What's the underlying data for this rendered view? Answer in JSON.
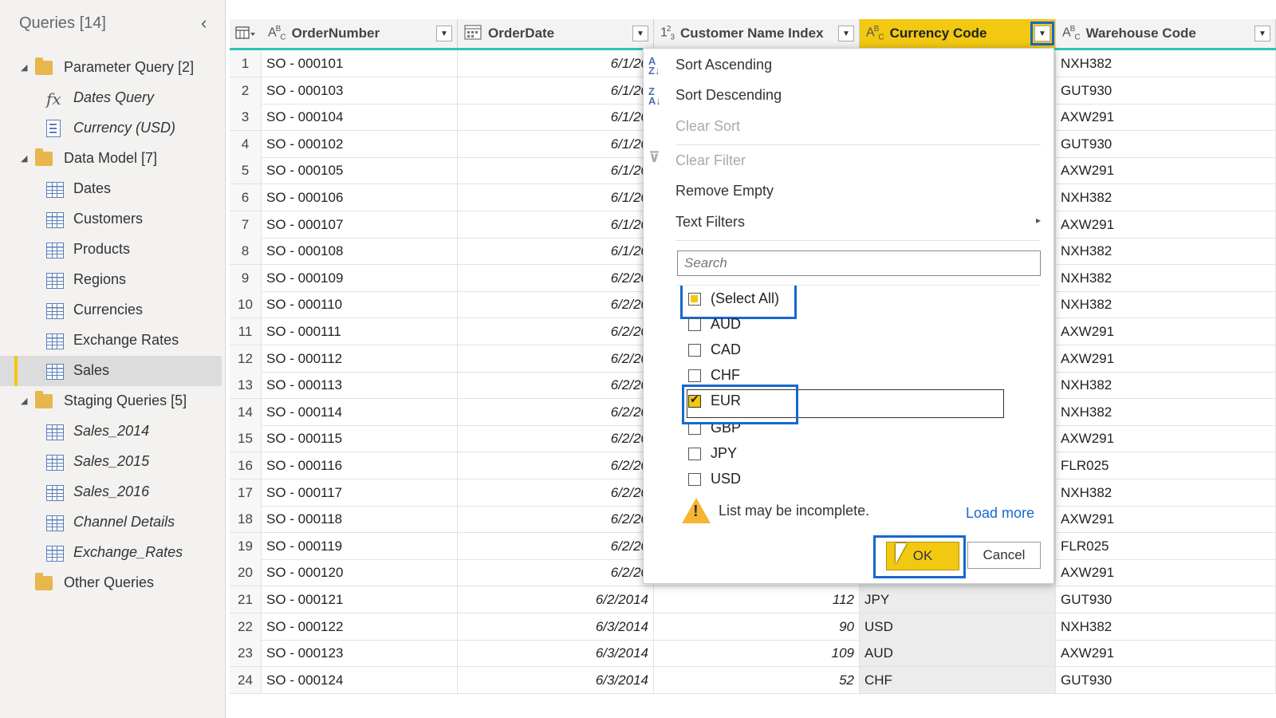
{
  "sidebar": {
    "title": "Queries [14]",
    "items": [
      {
        "label": "Parameter Query [2]",
        "type": "folder"
      },
      {
        "label": "Dates Query",
        "type": "fx"
      },
      {
        "label": "Currency (USD)",
        "type": "param"
      },
      {
        "label": "Data Model [7]",
        "type": "folder"
      },
      {
        "label": "Dates",
        "type": "table"
      },
      {
        "label": "Customers",
        "type": "table"
      },
      {
        "label": "Products",
        "type": "table"
      },
      {
        "label": "Regions",
        "type": "table"
      },
      {
        "label": "Currencies",
        "type": "table"
      },
      {
        "label": "Exchange Rates",
        "type": "table"
      },
      {
        "label": "Sales",
        "type": "table",
        "selected": true
      },
      {
        "label": "Staging Queries [5]",
        "type": "folder"
      },
      {
        "label": "Sales_2014",
        "type": "table"
      },
      {
        "label": "Sales_2015",
        "type": "table"
      },
      {
        "label": "Sales_2016",
        "type": "table"
      },
      {
        "label": "Channel Details",
        "type": "table"
      },
      {
        "label": "Exchange_Rates",
        "type": "table"
      },
      {
        "label": "Other Queries",
        "type": "folder"
      }
    ]
  },
  "grid": {
    "columns": [
      {
        "name": "OrderNumber",
        "type_icon": "ABC"
      },
      {
        "name": "OrderDate",
        "type_icon": "calendar"
      },
      {
        "name": "Customer Name Index",
        "type_icon": "123"
      },
      {
        "name": "Currency Code",
        "type_icon": "ABC"
      },
      {
        "name": "Warehouse Code",
        "type_icon": "ABC"
      }
    ],
    "rows": [
      [
        "1",
        "SO - 000101",
        "6/1/20",
        "",
        "",
        "NXH382"
      ],
      [
        "2",
        "SO - 000103",
        "6/1/20",
        "",
        "",
        "GUT930"
      ],
      [
        "3",
        "SO - 000104",
        "6/1/20",
        "",
        "",
        "AXW291"
      ],
      [
        "4",
        "SO - 000102",
        "6/1/20",
        "",
        "",
        "GUT930"
      ],
      [
        "5",
        "SO - 000105",
        "6/1/20",
        "",
        "",
        "AXW291"
      ],
      [
        "6",
        "SO - 000106",
        "6/1/20",
        "",
        "",
        "NXH382"
      ],
      [
        "7",
        "SO - 000107",
        "6/1/20",
        "",
        "",
        "AXW291"
      ],
      [
        "8",
        "SO - 000108",
        "6/1/20",
        "",
        "",
        "NXH382"
      ],
      [
        "9",
        "SO - 000109",
        "6/2/20",
        "",
        "",
        "NXH382"
      ],
      [
        "10",
        "SO - 000110",
        "6/2/20",
        "",
        "",
        "NXH382"
      ],
      [
        "11",
        "SO - 000111",
        "6/2/20",
        "",
        "",
        "AXW291"
      ],
      [
        "12",
        "SO - 000112",
        "6/2/20",
        "",
        "",
        "AXW291"
      ],
      [
        "13",
        "SO - 000113",
        "6/2/20",
        "",
        "",
        "NXH382"
      ],
      [
        "14",
        "SO - 000114",
        "6/2/20",
        "",
        "",
        "NXH382"
      ],
      [
        "15",
        "SO - 000115",
        "6/2/20",
        "",
        "",
        "AXW291"
      ],
      [
        "16",
        "SO - 000116",
        "6/2/20",
        "",
        "",
        "FLR025"
      ],
      [
        "17",
        "SO - 000117",
        "6/2/20",
        "",
        "",
        "NXH382"
      ],
      [
        "18",
        "SO - 000118",
        "6/2/20",
        "",
        "",
        "AXW291"
      ],
      [
        "19",
        "SO - 000119",
        "6/2/20",
        "",
        "",
        "FLR025"
      ],
      [
        "20",
        "SO - 000120",
        "6/2/20",
        "",
        "",
        "AXW291"
      ],
      [
        "21",
        "SO - 000121",
        "6/2/2014",
        "112",
        "JPY",
        "GUT930"
      ],
      [
        "22",
        "SO - 000122",
        "6/3/2014",
        "90",
        "USD",
        "NXH382"
      ],
      [
        "23",
        "SO - 000123",
        "6/3/2014",
        "109",
        "AUD",
        "AXW291"
      ],
      [
        "24",
        "SO - 000124",
        "6/3/2014",
        "52",
        "CHF",
        "GUT930"
      ]
    ]
  },
  "dropdown": {
    "sort_asc": "Sort Ascending",
    "sort_desc": "Sort Descending",
    "clear_sort": "Clear Sort",
    "clear_filter": "Clear Filter",
    "remove_empty": "Remove Empty",
    "text_filters": "Text Filters",
    "search_placeholder": "Search",
    "select_all": "(Select All)",
    "options": [
      {
        "label": "AUD",
        "checked": false
      },
      {
        "label": "CAD",
        "checked": false
      },
      {
        "label": "CHF",
        "checked": false
      },
      {
        "label": "EUR",
        "checked": true
      },
      {
        "label": "GBP",
        "checked": false
      },
      {
        "label": "JPY",
        "checked": false
      },
      {
        "label": "USD",
        "checked": false
      }
    ],
    "warning": "List may be incomplete.",
    "load_more": "Load more",
    "ok": "OK",
    "cancel": "Cancel"
  },
  "colors": {
    "accent": "#f2c811",
    "highlight": "#1668d0",
    "header_underline": "#2ec4b6"
  }
}
